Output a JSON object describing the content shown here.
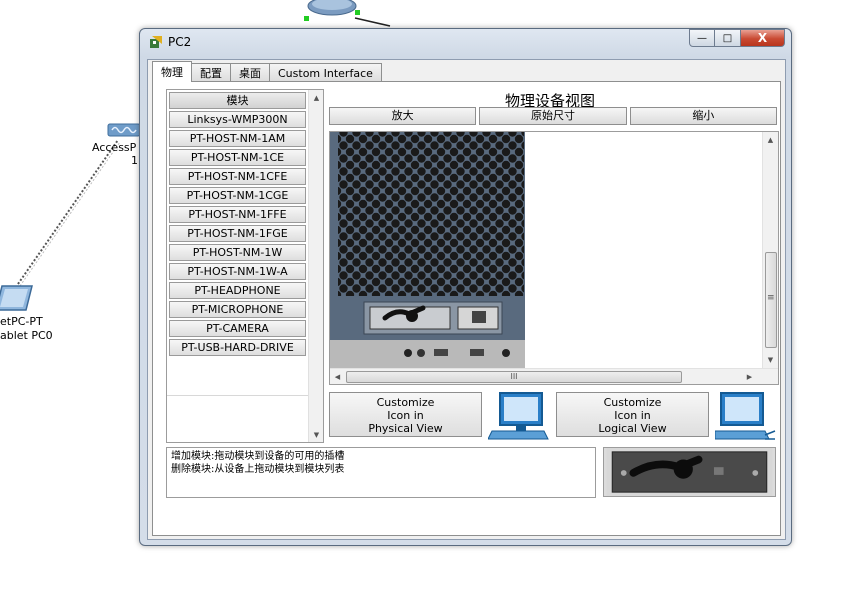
{
  "background": {
    "ap_label": "AccessP",
    "ap_number": "1",
    "tablet_label_line1": "etPC-PT",
    "tablet_label_line2": "ablet PC0"
  },
  "window": {
    "title": "PC2",
    "controls": {
      "minimize": "—",
      "maximize": "□",
      "close": "X"
    }
  },
  "tabs": [
    {
      "label": "物理",
      "active": true
    },
    {
      "label": "配置",
      "active": false
    },
    {
      "label": "桌面",
      "active": false
    },
    {
      "label": "Custom Interface",
      "active": false
    }
  ],
  "modules": {
    "header": "模块",
    "items": [
      "Linksys-WMP300N",
      "PT-HOST-NM-1AM",
      "PT-HOST-NM-1CE",
      "PT-HOST-NM-1CFE",
      "PT-HOST-NM-1CGE",
      "PT-HOST-NM-1FFE",
      "PT-HOST-NM-1FGE",
      "PT-HOST-NM-1W",
      "PT-HOST-NM-1W-A",
      "PT-HEADPHONE",
      "PT-MICROPHONE",
      "PT-CAMERA",
      "PT-USB-HARD-DRIVE"
    ]
  },
  "physical_view": {
    "title": "物理设备视图",
    "zoom_in": "放大",
    "original_size": "原始尺寸",
    "zoom_out": "缩小",
    "hscroll_grip": "III",
    "vscroll_grip": "≡"
  },
  "customize": {
    "physical": {
      "line1": "Customize",
      "line2": "Icon in",
      "line3": "Physical View"
    },
    "logical": {
      "line1": "Customize",
      "line2": "Icon in",
      "line3": "Logical View"
    }
  },
  "info": {
    "line1": "增加模块:拖动模块到设备的可用的插槽",
    "line2": "删除模块:从设备上拖动模块到模块列表"
  },
  "colors": {
    "close_button": "#c94a33",
    "device_panel": "#596a7e",
    "device_bezel": "#b9b9b9"
  }
}
